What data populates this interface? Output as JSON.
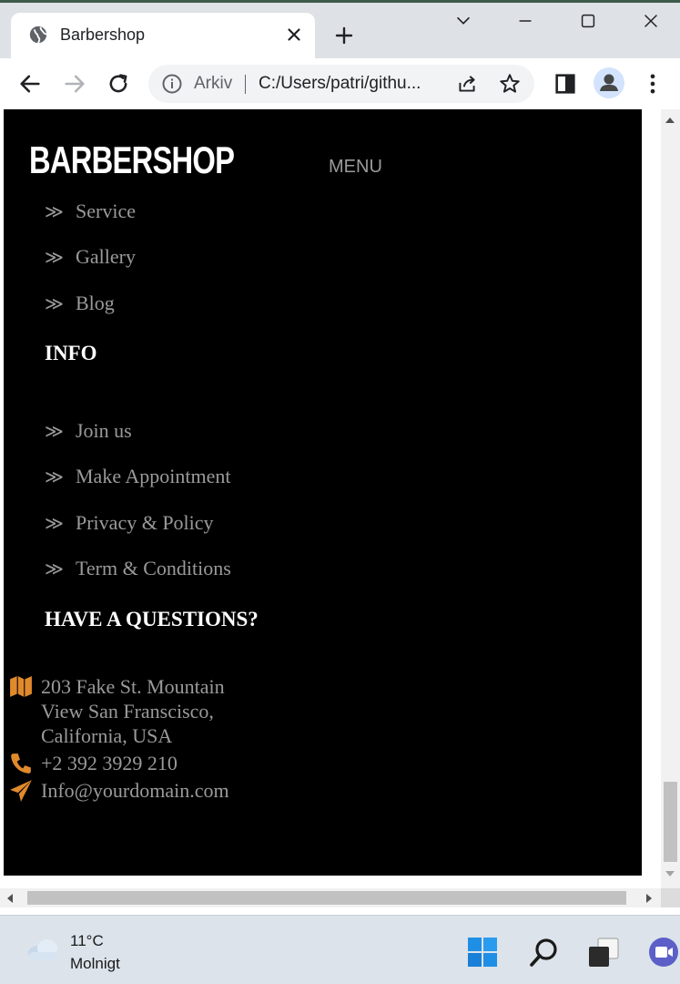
{
  "browser": {
    "tab_title": "Barbershop",
    "address_label": "Arkiv",
    "address_url": "C:/Users/patri/githu..."
  },
  "site": {
    "logo": "BARBERSHOP",
    "menu_label": "MENU",
    "arrow": "≫",
    "nav_links": [
      "Service",
      "Gallery",
      "Blog"
    ],
    "info_title": "INFO",
    "info_links": [
      "Join us",
      "Make Appointment",
      "Privacy & Policy",
      "Term & Conditions"
    ],
    "questions_title": "HAVE A QUESTIONS?",
    "contact": {
      "address_lines": [
        "203 Fake St. Mountain",
        "View San Franscisco,",
        "California, USA"
      ],
      "phone": "+2 392 3929 210",
      "email": "Info@yourdomain.com"
    },
    "accent_color": "#e08a2c"
  },
  "taskbar": {
    "temperature": "11°C",
    "weather": "Molnigt"
  }
}
